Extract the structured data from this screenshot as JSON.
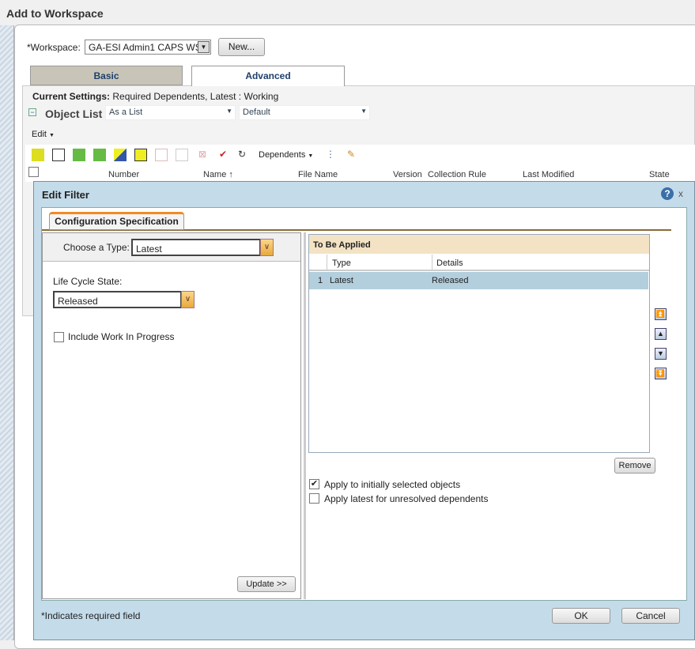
{
  "window": {
    "title": "Add to Workspace"
  },
  "workspace": {
    "label": "*Workspace:",
    "value": "GA-ESI Admin1 CAPS WS",
    "new_button": "New..."
  },
  "tabs": [
    {
      "label": "Basic",
      "active": false
    },
    {
      "label": "Advanced",
      "active": true
    }
  ],
  "current_settings": {
    "label": "Current Settings:",
    "value": "Required Dependents, Latest : Working"
  },
  "object_list": {
    "title": "Object List",
    "view": "As a List",
    "table_view": "Default"
  },
  "edit_menu": "Edit",
  "toolbar": {
    "dependents": "Dependents"
  },
  "columns": [
    "Number",
    "Name ↑",
    "File Name",
    "Version",
    "Collection Rule",
    "Last Modified",
    "State"
  ],
  "dialog": {
    "title": "Edit Filter",
    "close": "x",
    "tab": "Configuration Specification",
    "choose_type_label": "Choose a Type:",
    "choose_type_value": "Latest",
    "lifecycle_label": "Life Cycle State:",
    "lifecycle_value": "Released",
    "include_wip": {
      "label": "Include Work In Progress",
      "checked": false
    },
    "update_button": "Update >>",
    "to_be_applied": {
      "title": "To Be Applied",
      "columns": [
        "Type",
        "Details"
      ],
      "rows": [
        {
          "index": "1",
          "type": "Latest",
          "details": "Released",
          "selected": true
        }
      ]
    },
    "remove_button": "Remove",
    "apply_initial": {
      "label": "Apply to initially selected objects",
      "checked": true
    },
    "apply_latest": {
      "label": "Apply latest for unresolved dependents",
      "checked": false
    },
    "required_note": "*Indicates required field",
    "ok": "OK",
    "cancel": "Cancel"
  },
  "colors": {
    "dialog_bg": "#c4dcea",
    "selected_row": "#b3cfdd",
    "header_beige": "#f3e3c4",
    "tab_accent": "#f08a24"
  }
}
